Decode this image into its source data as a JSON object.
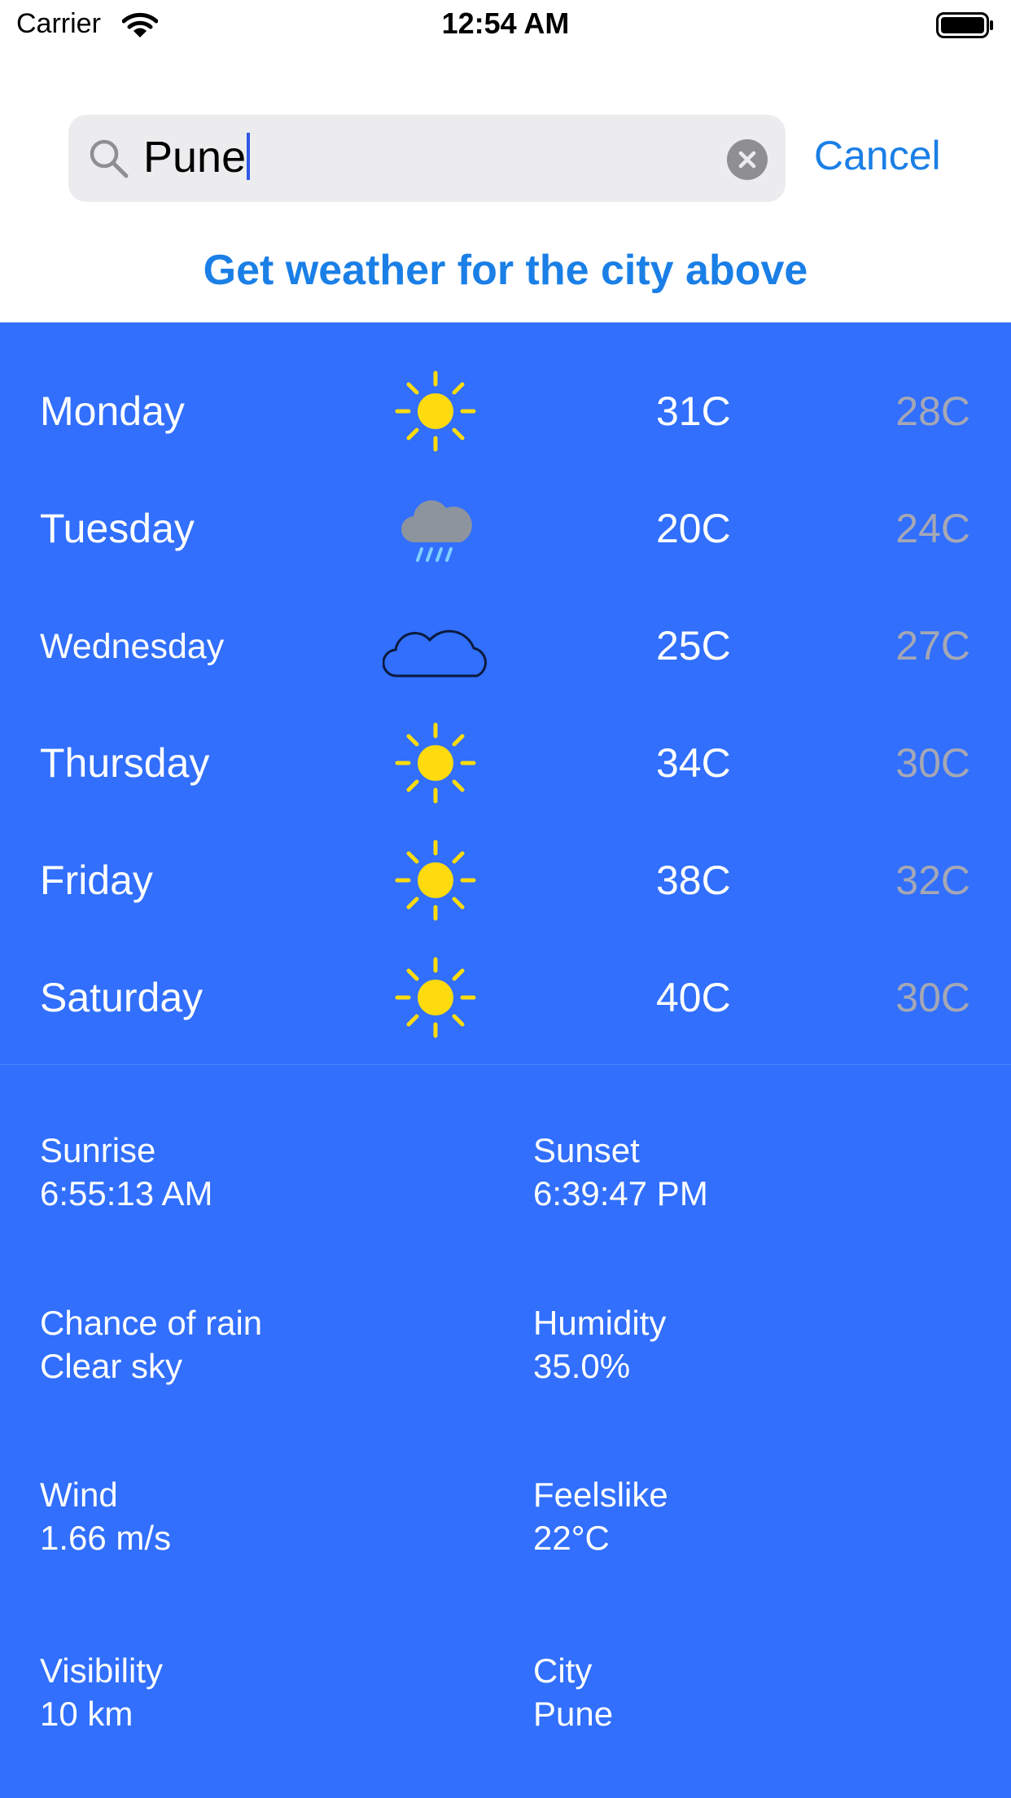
{
  "status_bar": {
    "carrier": "Carrier",
    "time": "12:54 AM"
  },
  "search": {
    "value": "Pune",
    "cancel_label": "Cancel"
  },
  "cta_label": "Get weather for the city above",
  "forecast": [
    {
      "day": "Monday",
      "icon": "sun-icon",
      "high": "31C",
      "low": "28C"
    },
    {
      "day": "Tuesday",
      "icon": "rain-cloud-icon",
      "high": "20C",
      "low": "24C"
    },
    {
      "day": "Wednesday",
      "icon": "cloud-icon",
      "high": "25C",
      "low": "27C"
    },
    {
      "day": "Thursday",
      "icon": "sun-icon",
      "high": "34C",
      "low": "30C"
    },
    {
      "day": "Friday",
      "icon": "sun-icon",
      "high": "38C",
      "low": "32C"
    },
    {
      "day": "Saturday",
      "icon": "sun-icon",
      "high": "40C",
      "low": "30C"
    }
  ],
  "details": {
    "sunrise": {
      "label": "Sunrise",
      "value": "6:55:13 AM"
    },
    "sunset": {
      "label": "Sunset",
      "value": "6:39:47 PM"
    },
    "chance_of_rain": {
      "label": "Chance of rain",
      "value": "Clear sky"
    },
    "humidity": {
      "label": "Humidity",
      "value": "35.0%"
    },
    "wind": {
      "label": "Wind",
      "value": "1.66 m/s"
    },
    "feelslike": {
      "label": "Feelslike",
      "value": "22°C"
    },
    "visibility": {
      "label": "Visibility",
      "value": "10 km"
    },
    "city": {
      "label": "City",
      "value": "Pune"
    }
  },
  "colors": {
    "panel": "#316ffc",
    "accent": "#1a7fe6",
    "low_temp": "#a5a7b5",
    "sun": "#fddb0f"
  }
}
